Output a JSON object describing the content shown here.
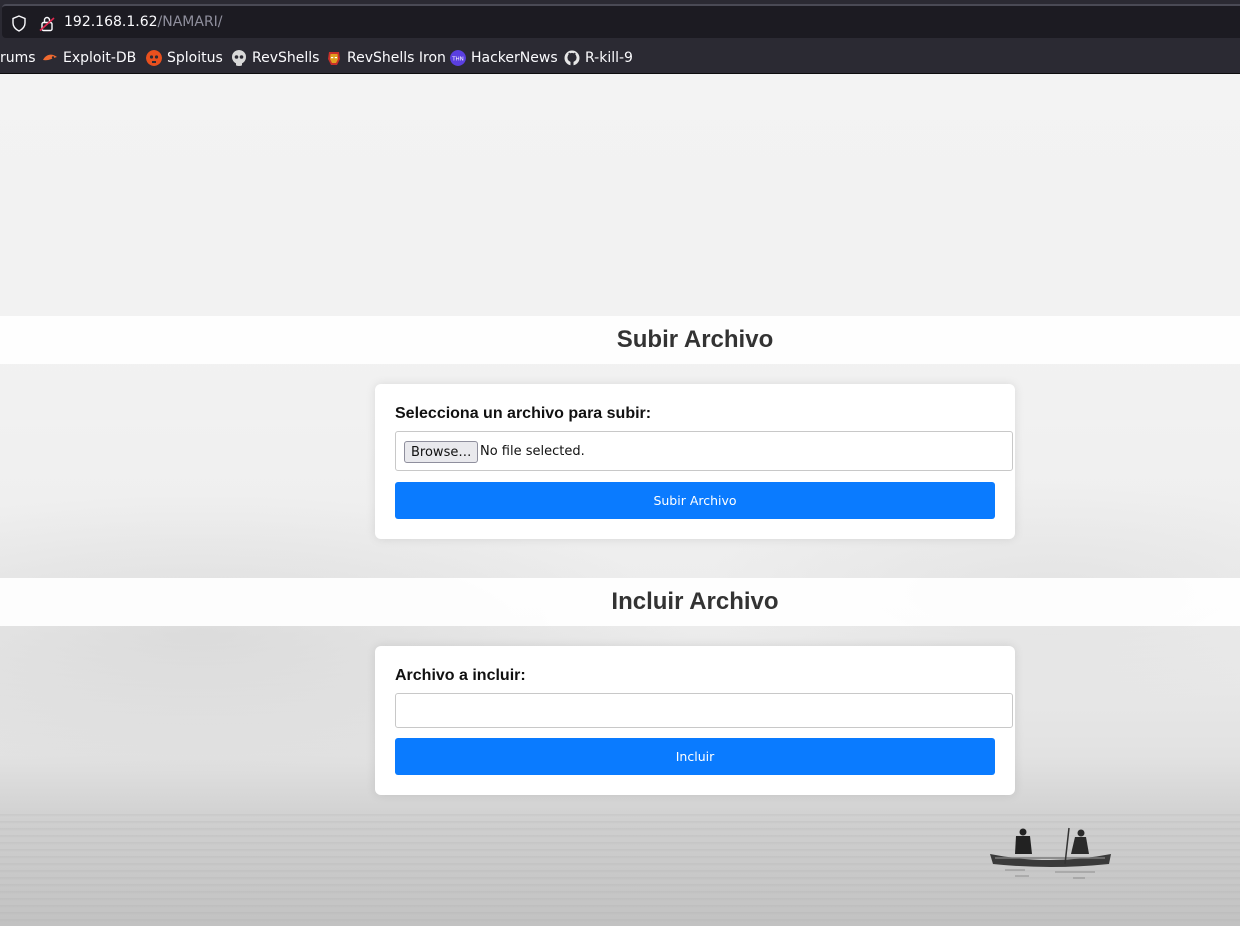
{
  "browser": {
    "url_host": "192.168.1.62",
    "url_path": "/NAMARI/",
    "bookmarks": [
      {
        "label": "rums",
        "icon": "forum-icon",
        "color": ""
      },
      {
        "label": "Exploit-DB",
        "icon": "exploit-db-icon",
        "color": "#f06a30"
      },
      {
        "label": "Sploitus",
        "icon": "sploitus-skull-icon",
        "color": "#e8501e"
      },
      {
        "label": "RevShells",
        "icon": "skull-icon",
        "color": "#d9d9d9"
      },
      {
        "label": "RevShells Iron",
        "icon": "iron-man-icon",
        "color": "#e0a020"
      },
      {
        "label": "HackerNews",
        "icon": "hackernews-icon",
        "color": "#5a3fe0"
      },
      {
        "label": "R-kill-9",
        "icon": "github-icon",
        "color": "#e6e6e6"
      }
    ]
  },
  "upload_section": {
    "title": "Subir Archivo",
    "label": "Selecciona un archivo para subir:",
    "browse_label": "Browse…",
    "file_status": "No file selected.",
    "submit_label": "Subir Archivo"
  },
  "include_section": {
    "title": "Incluir Archivo",
    "label": "Archivo a incluir:",
    "input_value": "",
    "submit_label": "Incluir"
  },
  "colors": {
    "primary_button": "#0a7bff",
    "heading_text": "#333333"
  }
}
